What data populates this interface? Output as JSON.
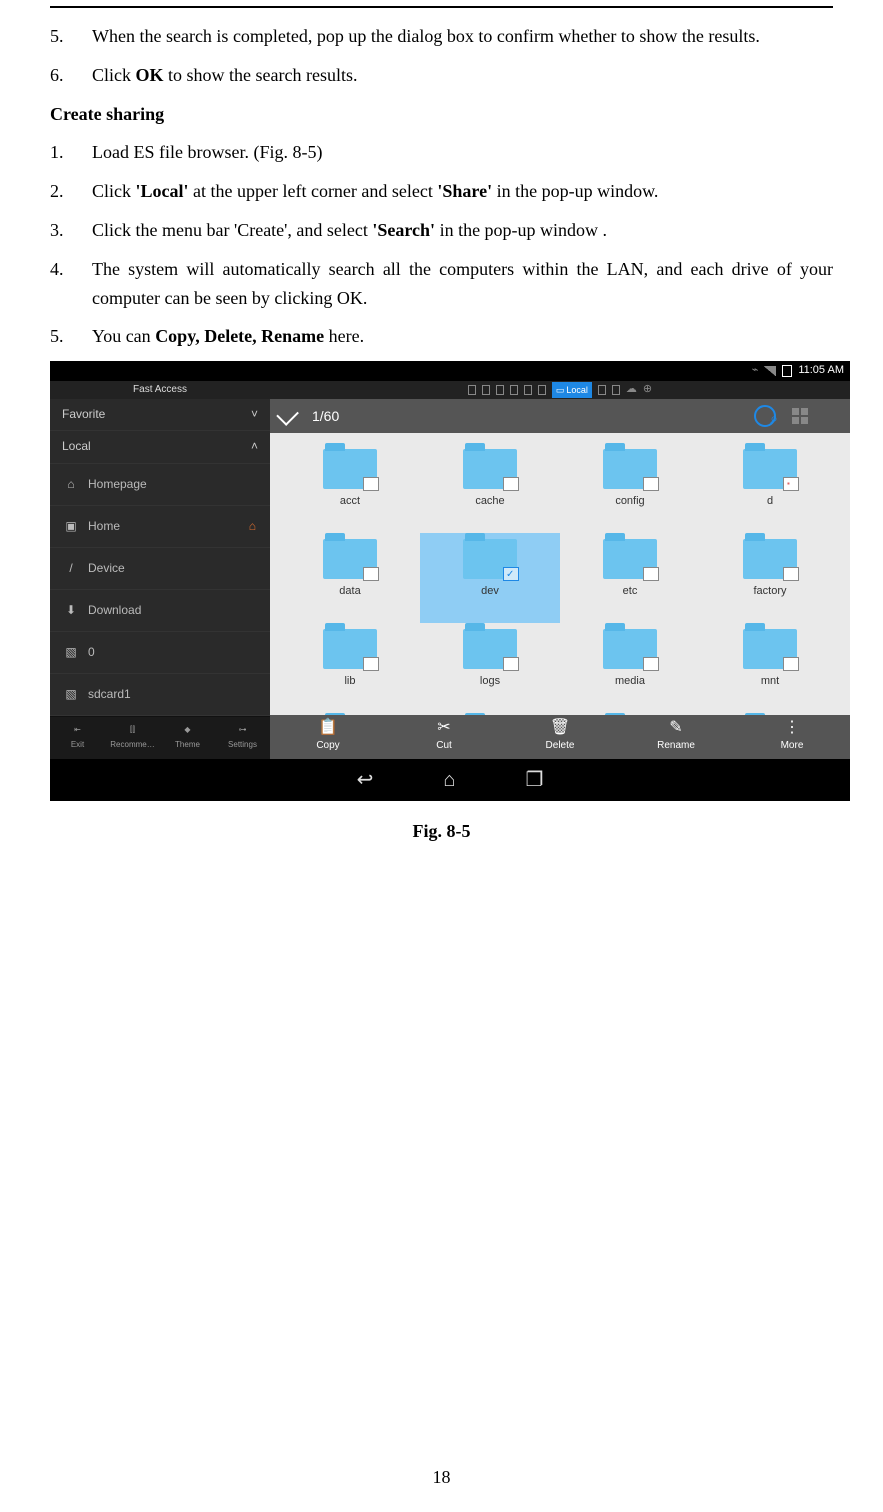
{
  "doc": {
    "list_a": [
      {
        "n": "5.",
        "t": "When the search is completed, pop up the dialog box to confirm whether to show the results."
      },
      {
        "n": "6.",
        "parts": [
          "Click ",
          "OK",
          " to show the search results."
        ]
      }
    ],
    "heading": "Create sharing",
    "list_b": [
      {
        "n": "1.",
        "parts": [
          "Load ES file browser. (Fig. 8-5)"
        ]
      },
      {
        "n": "2.",
        "parts": [
          "Click ",
          "'Local'",
          " at the upper left corner and select ",
          "'Share'",
          " in the pop-up window."
        ]
      },
      {
        "n": "3.",
        "parts": [
          "Click the menu bar 'Create', and select ",
          "'Search'",
          " in the pop-up window ."
        ]
      },
      {
        "n": "4.",
        "parts": [
          "The system will automatically search all the computers within the LAN, and each drive of your computer can be seen by clicking OK."
        ]
      },
      {
        "n": "5.",
        "parts": [
          "You can ",
          "Copy, Delete, Rename",
          " here."
        ]
      }
    ],
    "figure_caption": "Fig. 8-5",
    "page_number": "18"
  },
  "shot": {
    "status": {
      "time": "11:05 AM"
    },
    "appbar": {
      "fast_access": "Fast Access",
      "local_tab": "Local"
    },
    "sidebar": {
      "sections": [
        {
          "label": "Favorite",
          "expand": "˅"
        },
        {
          "label": "Local",
          "expand": "˄"
        }
      ],
      "items": [
        {
          "icon": "⌂",
          "label": "Homepage",
          "home": false
        },
        {
          "icon": "▣",
          "label": "Home",
          "home": true
        },
        {
          "icon": "/",
          "label": "Device",
          "home": false
        },
        {
          "icon": "⬇",
          "label": "Download",
          "home": false
        },
        {
          "icon": "▧",
          "label": "0",
          "home": false
        },
        {
          "icon": "▧",
          "label": "sdcard1",
          "home": false
        }
      ],
      "bottom": [
        {
          "icon": "⇤",
          "label": "Exit"
        },
        {
          "icon": "⫿⫿",
          "label": "Recomme…"
        },
        {
          "icon": "◆",
          "label": "Theme"
        },
        {
          "icon": "⊶",
          "label": "Settings"
        }
      ]
    },
    "main": {
      "path": "1/60",
      "files": [
        {
          "name": "acct",
          "sel": false
        },
        {
          "name": "cache",
          "sel": false
        },
        {
          "name": "config",
          "sel": false
        },
        {
          "name": "d",
          "sel": false,
          "pad": true
        },
        {
          "name": "data",
          "sel": false
        },
        {
          "name": "dev",
          "sel": true
        },
        {
          "name": "etc",
          "sel": false
        },
        {
          "name": "factory",
          "sel": false
        },
        {
          "name": "lib",
          "sel": false
        },
        {
          "name": "logs",
          "sel": false
        },
        {
          "name": "media",
          "sel": false
        },
        {
          "name": "mnt",
          "sel": false
        },
        {
          "name": "",
          "sel": false
        },
        {
          "name": "",
          "sel": false
        },
        {
          "name": "",
          "sel": false
        },
        {
          "name": "",
          "sel": false
        }
      ],
      "actions": [
        {
          "icon": "📋",
          "label": "Copy"
        },
        {
          "icon": "✂",
          "label": "Cut"
        },
        {
          "icon": "🗑",
          "label": "Delete"
        },
        {
          "icon": "✎",
          "label": "Rename"
        },
        {
          "icon": "⋮",
          "label": "More"
        }
      ]
    }
  }
}
